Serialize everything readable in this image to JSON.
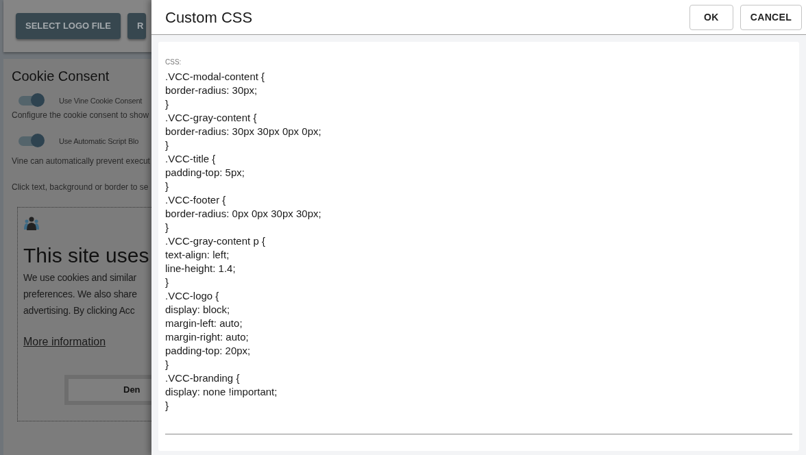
{
  "background": {
    "buttons": [
      "SELECT LOGO FILE",
      "R"
    ],
    "section_title": "Cookie Consent",
    "toggles": [
      {
        "label": "Use Vine Cookie Consent",
        "on": true,
        "description": "Configure the cookie consent to show"
      },
      {
        "label": "Use Automatic Script Blo",
        "on": true,
        "description": "Vine can automatically prevent execut"
      }
    ],
    "hint": "Click text, background or border to se",
    "preview": {
      "heading": "This site uses",
      "body": [
        "We use cookies and similar",
        "preferences. We also share",
        "advertising. By clicking Acc"
      ],
      "link": "More information",
      "button": "Den"
    }
  },
  "dialog": {
    "title": "Custom CSS",
    "buttons": [
      "OK",
      "CANCEL"
    ],
    "field_label": "CSS:",
    "css": ".VCC-modal-content {\nborder-radius: 30px;\n}\n.VCC-gray-content {\nborder-radius: 30px 30px 0px 0px;\n}\n.VCC-title {\npadding-top: 5px;\n}\n.VCC-footer {\nborder-radius: 0px 0px 30px 30px;\n}\n.VCC-gray-content p {\ntext-align: left;\nline-height: 1.4;\n}\n.VCC-logo {\ndisplay: block;\nmargin-left: auto;\nmargin-right: auto;\npadding-top: 20px;\n}\n.VCC-branding {\ndisplay: none !important;\n}"
  }
}
